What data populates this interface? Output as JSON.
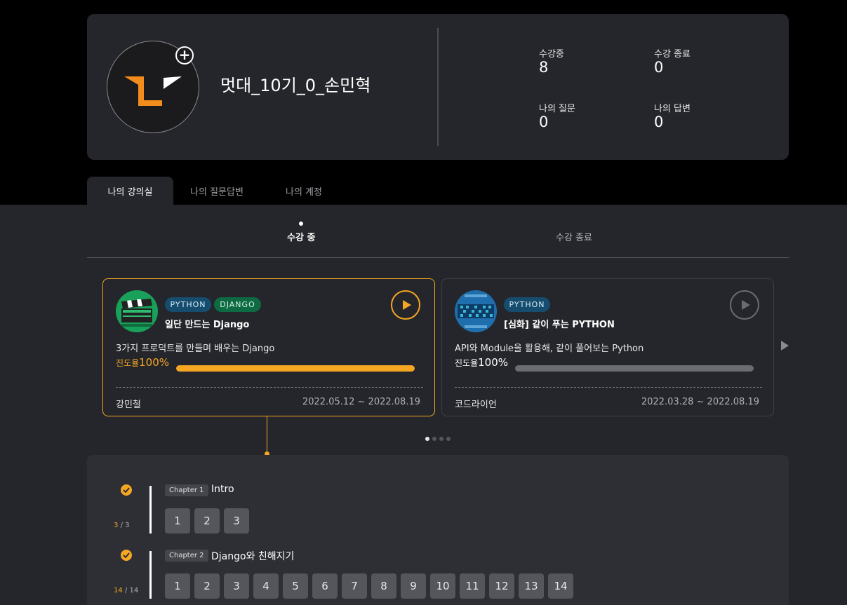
{
  "profile": {
    "username": "멋대_10기_0_손민혁",
    "stats": [
      {
        "label": "수강중",
        "value": "8"
      },
      {
        "label": "수강 종료",
        "value": "0"
      },
      {
        "label": "나의 질문",
        "value": "0"
      },
      {
        "label": "나의 답변",
        "value": "0"
      }
    ]
  },
  "tabs": [
    "나의 강의실",
    "나의 질문답변",
    "나의 계정"
  ],
  "subtabs": [
    "수강 중",
    "수강 종료"
  ],
  "courses": [
    {
      "tags": [
        "PYTHON",
        "DJANGO"
      ],
      "title": "일단 만드는 Django",
      "description": "3가지 프로덕트를 만들며 배우는 Django",
      "progress_label": "진도율",
      "progress_value": "100%",
      "progress": 100,
      "teacher": "강민철",
      "period": "2022.05.12 ~ 2022.08.19",
      "accent": "#f5a623"
    },
    {
      "tags": [
        "PYTHON"
      ],
      "title": "[심화] 같이 푸는 PYTHON",
      "description": "API와 Module을 활용해, 같이 풀어보는 Python",
      "progress_label": "진도율",
      "progress_value": "100%",
      "progress": 100,
      "teacher": "코드라이언",
      "period": "2022.03.28 ~ 2022.08.19",
      "accent": "#6b6c72"
    }
  ],
  "chapters": [
    {
      "badge": "Chapter 1",
      "title": "Intro",
      "done": "3",
      "total": "/ 3",
      "lessons": [
        "1",
        "2",
        "3"
      ]
    },
    {
      "badge": "Chapter 2",
      "title": "Django와 친해지기",
      "done": "14",
      "total": "/ 14",
      "lessons": [
        "1",
        "2",
        "3",
        "4",
        "5",
        "6",
        "7",
        "8",
        "9",
        "10",
        "11",
        "12",
        "13",
        "14"
      ]
    }
  ],
  "colors": {
    "accent": "#f5a623",
    "bg": "#25262b"
  }
}
